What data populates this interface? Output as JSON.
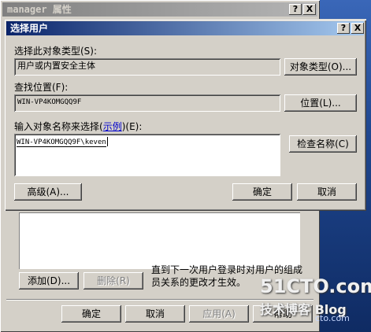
{
  "bg_window": {
    "title": "manager 属性",
    "help_btn": "?",
    "close_btn": "X",
    "add_button": "添加(D)...",
    "remove_button": "删除(R)",
    "note": "直到下一次用户登录时对用户的组成员关系的更改才生效。",
    "ok_button": "确定",
    "cancel_button": "取消",
    "apply_button": "应用(A)",
    "help_button": "帮助"
  },
  "dialog": {
    "title": "选择用户",
    "help_btn": "?",
    "close_btn": "X",
    "object_type_label": "选择此对象类型(S):",
    "object_type_value": "用户或内置安全主体",
    "object_type_button": "对象类型(O)...",
    "location_label": "查找位置(F):",
    "location_value": "WIN-VP4KOMGQQ9F",
    "location_button": "位置(L)...",
    "names_label_prefix": "输入对象名称来选择(",
    "names_label_link": "示例",
    "names_label_suffix": ")(E):",
    "names_value": "WIN-VP4KOMGQQ9F\\keven",
    "check_names_button": "检查名称(C)",
    "advanced_button": "高级(A)...",
    "ok_button": "确定",
    "cancel_button": "取消"
  },
  "watermark": {
    "site": "51CTO.com",
    "blog": "技术博客",
    "blog_extra": "Blog",
    "url": "cto.com"
  }
}
